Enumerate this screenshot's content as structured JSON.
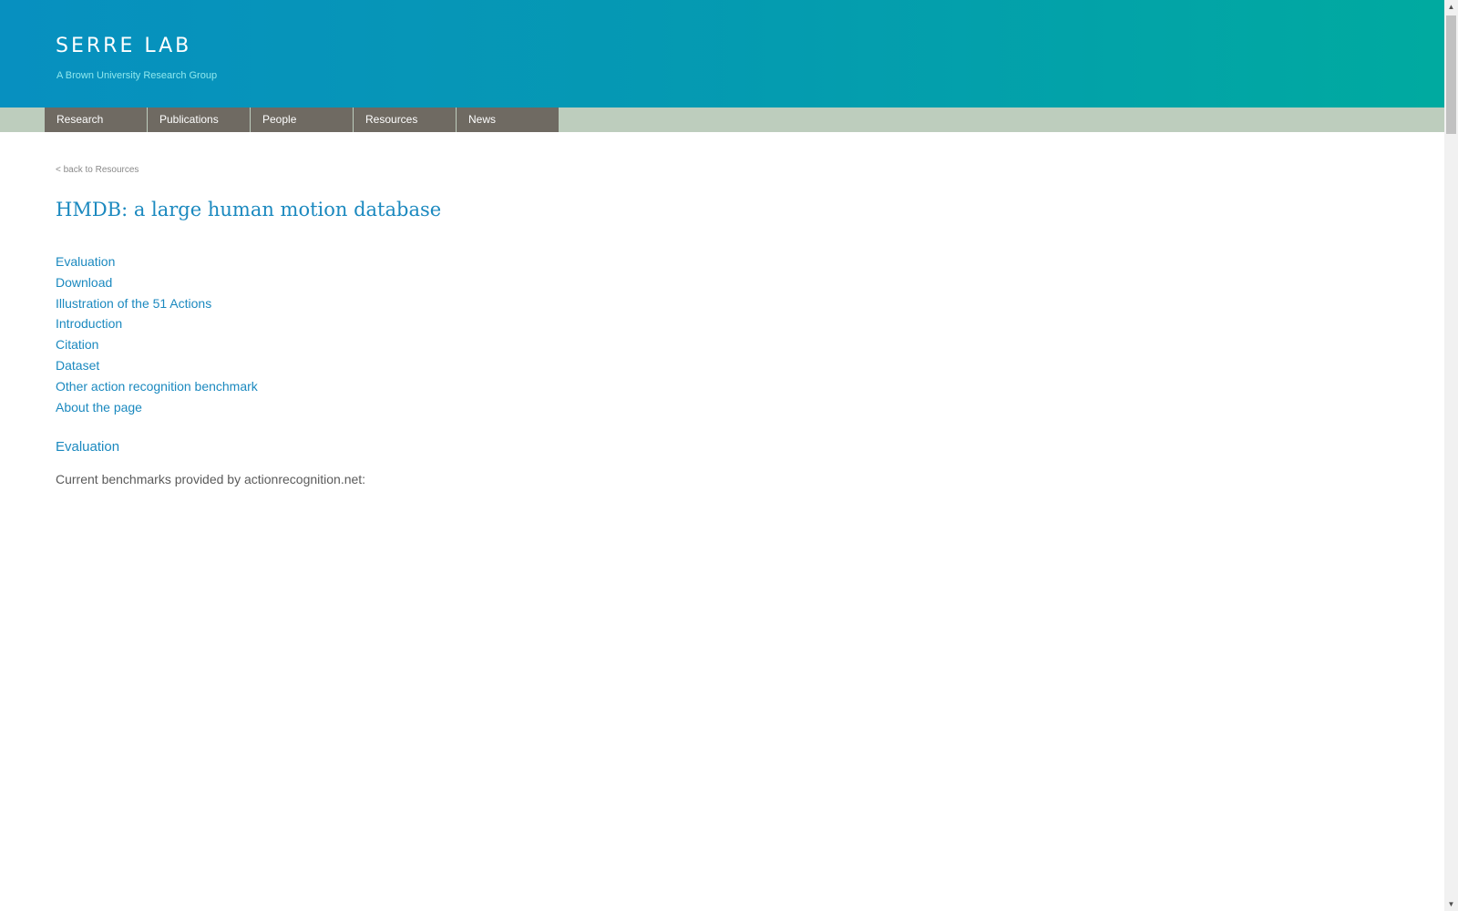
{
  "header": {
    "site_title": "SERRE LAB",
    "tagline": "A Brown University Research Group"
  },
  "nav": {
    "items": [
      {
        "label": "Research"
      },
      {
        "label": "Publications"
      },
      {
        "label": "People"
      },
      {
        "label": "Resources"
      },
      {
        "label": "News"
      }
    ]
  },
  "content": {
    "back_link": "< back to Resources",
    "title": "HMDB: a large human motion database",
    "toc": [
      {
        "label": "Evaluation"
      },
      {
        "label": "Download"
      },
      {
        "label": "Illustration of the 51 Actions"
      },
      {
        "label": "Introduction"
      },
      {
        "label": "Citation"
      },
      {
        "label": "Dataset"
      },
      {
        "label": "Other action recognition benchmark"
      },
      {
        "label": "About the page"
      }
    ],
    "section": {
      "heading": "Evaluation",
      "text": "Current benchmarks provided by actionrecognition.net:"
    }
  },
  "colors": {
    "link": "#1b89bf",
    "nav_bg": "#6f6a62",
    "nav_bar": "#bdcdbd",
    "header_start": "#0790c0",
    "header_end": "#00aaa0"
  },
  "scrollbar": {
    "up_icon": "triangle-up-icon",
    "down_icon": "triangle-down-icon"
  }
}
